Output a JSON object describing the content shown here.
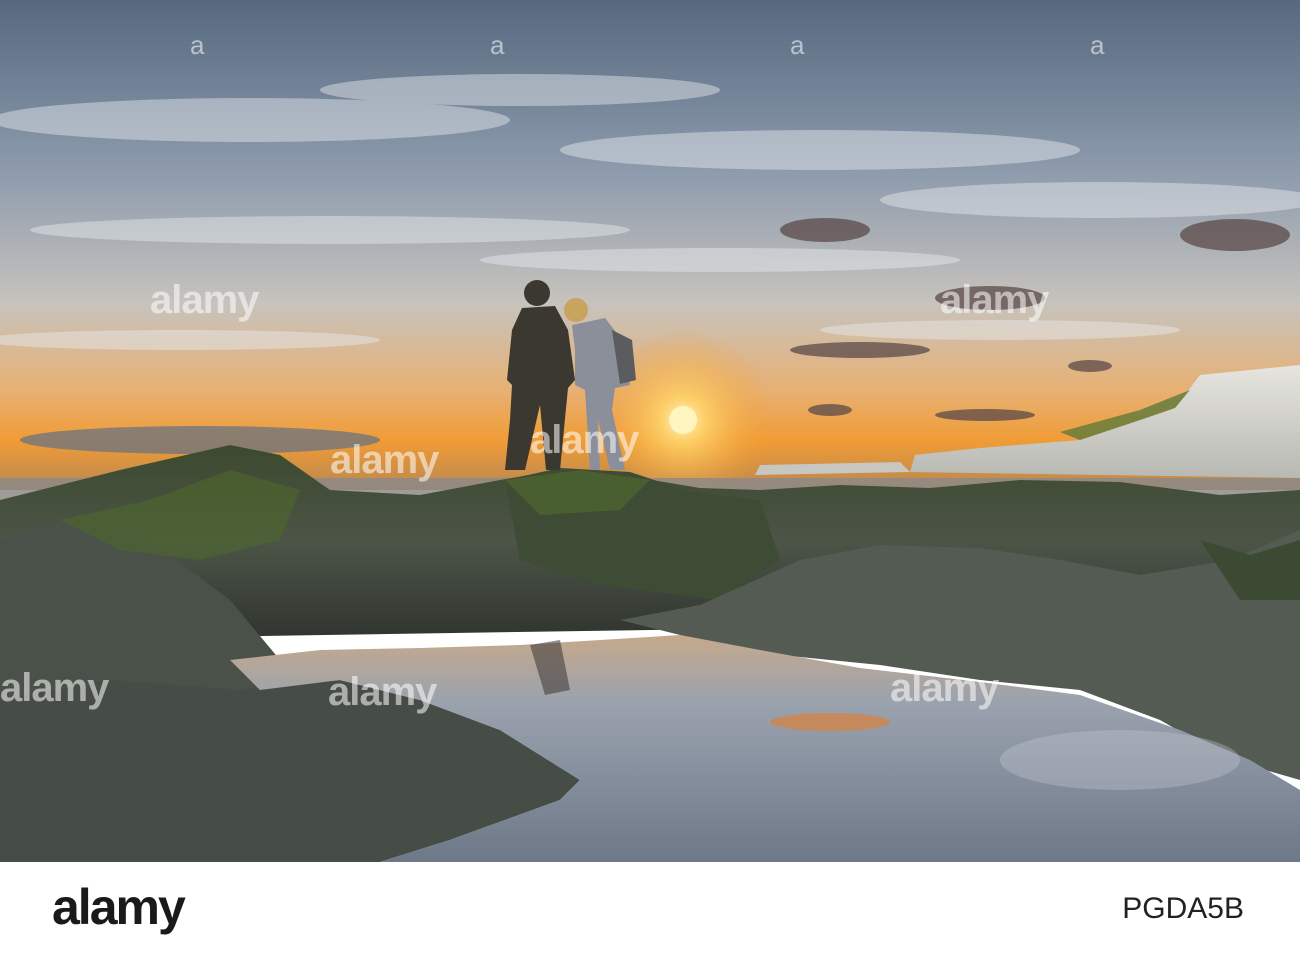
{
  "photo": {
    "subject": "Two people standing on rocks at sunset by a rock pool with white cliffs",
    "colors": {
      "sky_top": "#5d6f86",
      "sky_mid": "#c9cbcf",
      "horizon": "#f2a33a",
      "sun": "#fff2b0",
      "rock": "#3b463c",
      "algae": "#4f6a2a",
      "cliff": "#dcdcd6",
      "water": "#8f97a5"
    }
  },
  "watermarks": {
    "brand": "alamy",
    "image_id": "PGDA5B"
  },
  "footer": {
    "logo": "alamy",
    "image_id": "PGDA5B"
  }
}
